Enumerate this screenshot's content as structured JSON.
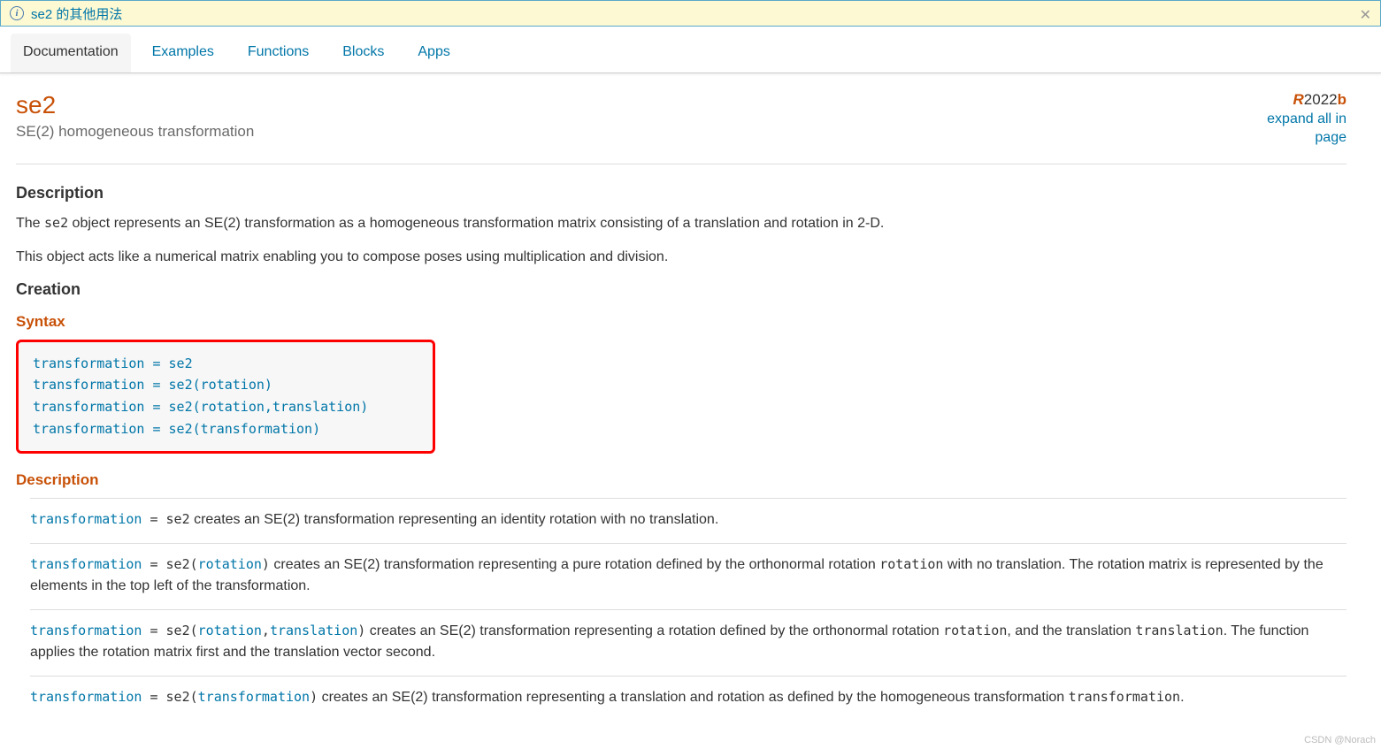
{
  "banner": {
    "text": "se2 的其他用法"
  },
  "tabs": [
    "Documentation",
    "Examples",
    "Functions",
    "Blocks",
    "Apps"
  ],
  "activeTab": 0,
  "page": {
    "title": "se2",
    "subtitle": "SE(2) homogeneous transformation",
    "version_r": "R",
    "version_y": "2022",
    "version_b": "b",
    "expand": "expand all in page"
  },
  "sections": {
    "description_h": "Description",
    "desc_p1a": "The ",
    "desc_p1_code": "se2",
    "desc_p1b": " object represents an SE(2) transformation as a homogeneous transformation matrix consisting of a translation and rotation in 2-D.",
    "desc_p2": "This object acts like a numerical matrix enabling you to compose poses using multiplication and division.",
    "creation_h": "Creation",
    "syntax_h": "Syntax",
    "syntax_lines": [
      "transformation = se2",
      "transformation = se2(rotation)",
      "transformation = se2(rotation,translation)",
      "transformation = se2(transformation)"
    ],
    "desc2_h": "Description"
  },
  "descriptions": [
    {
      "lhs": "transformation",
      "eq": " = se2",
      "rest": " creates an SE(2) transformation representing an identity rotation with no translation."
    },
    {
      "lhs": "transformation",
      "eq": " = se2(",
      "arg1": "rotation",
      "eq2": ")",
      "rest": " creates an SE(2) transformation representing a pure rotation defined by the orthonormal rotation ",
      "m1": "rotation",
      "rest2": " with no translation. The rotation matrix is represented by the elements in the top left of the transformation."
    },
    {
      "lhs": "transformation",
      "eq": " = se2(",
      "arg1": "rotation",
      "comma": ",",
      "arg2": "translation",
      "eq2": ")",
      "rest": " creates an SE(2) transformation representing a rotation defined by the orthonormal rotation ",
      "m1": "rotation",
      "rest2": ", and the translation ",
      "m2": "translation",
      "rest3": ". The function applies the rotation matrix first and the translation vector second."
    },
    {
      "lhs": "transformation",
      "eq": " = se2(",
      "arg1": "transformation",
      "eq2": ")",
      "rest": " creates an SE(2) transformation representing a translation and rotation as defined by the homogeneous transformation ",
      "m1": "transformation",
      "rest2": "."
    }
  ],
  "watermark": "CSDN @Norach"
}
